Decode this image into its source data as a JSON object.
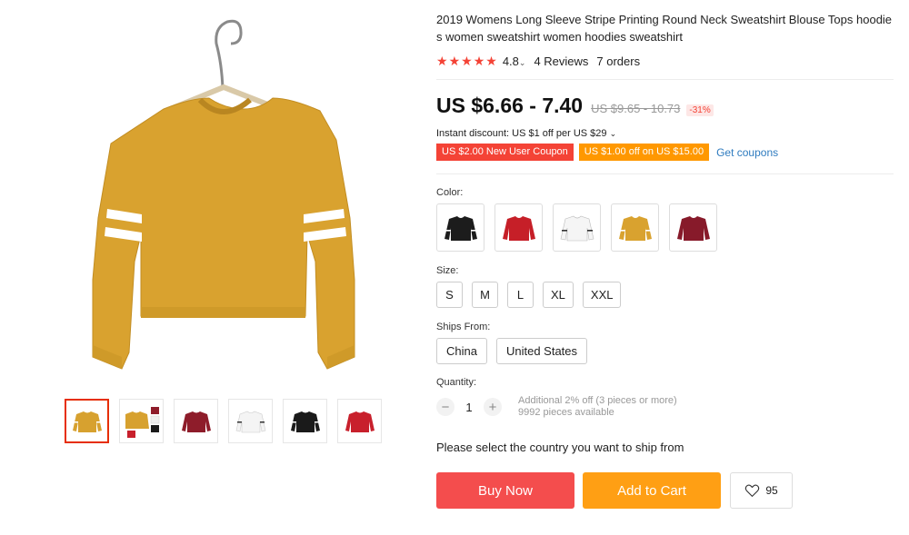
{
  "product": {
    "title": "2019 Womens Long Sleeve Stripe Printing Round Neck Sweatshirt Blouse Tops hoodies women sweatshirt women hoodies sweatshirt",
    "rating": "4.8",
    "reviews": "4 Reviews",
    "orders": "7 orders",
    "price": "US $6.66 - 7.40",
    "old_price": "US $9.65 - 10.73",
    "discount": "-31%",
    "instant_discount": "Instant discount: US $1 off per US $29",
    "coupon_new_user": "US $2.00 New User Coupon",
    "coupon_off": "US $1.00 off on US $15.00",
    "get_coupons": "Get coupons"
  },
  "gallery": {
    "thumbnails": [
      {
        "color": "#d7a12f",
        "name": "mustard"
      },
      {
        "color": "#d7a12f",
        "name": "collage"
      },
      {
        "color": "#8e1c2a",
        "name": "burgundy"
      },
      {
        "color": "#f4f4f4",
        "name": "white"
      },
      {
        "color": "#1a1a1a",
        "name": "black"
      },
      {
        "color": "#c8202c",
        "name": "red"
      }
    ]
  },
  "options": {
    "color_label": "Color:",
    "colors": [
      {
        "name": "black",
        "hex": "#1c1c1c"
      },
      {
        "name": "red",
        "hex": "#c61f28"
      },
      {
        "name": "white",
        "hex": "#f5f5f5"
      },
      {
        "name": "mustard",
        "hex": "#d9a22f"
      },
      {
        "name": "burgundy",
        "hex": "#871a2a"
      }
    ],
    "size_label": "Size:",
    "sizes": [
      "S",
      "M",
      "L",
      "XL",
      "XXL"
    ],
    "ships_label": "Ships From:",
    "ships_from": [
      "China",
      "United States"
    ],
    "quantity_label": "Quantity:",
    "quantity": "1",
    "qty_minus": "−",
    "qty_plus": "+",
    "qty_note_1": "Additional 2% off (3 pieces or more)",
    "qty_note_2": "9992 pieces available"
  },
  "ship_message": "Please select the country you want to ship from",
  "actions": {
    "buy_now": "Buy Now",
    "add_to_cart": "Add to Cart",
    "wishlist_count": "95"
  },
  "colors": {
    "accent_red": "#f44d4d",
    "accent_orange": "#ff9f14",
    "link_blue": "#2e7bbf"
  }
}
